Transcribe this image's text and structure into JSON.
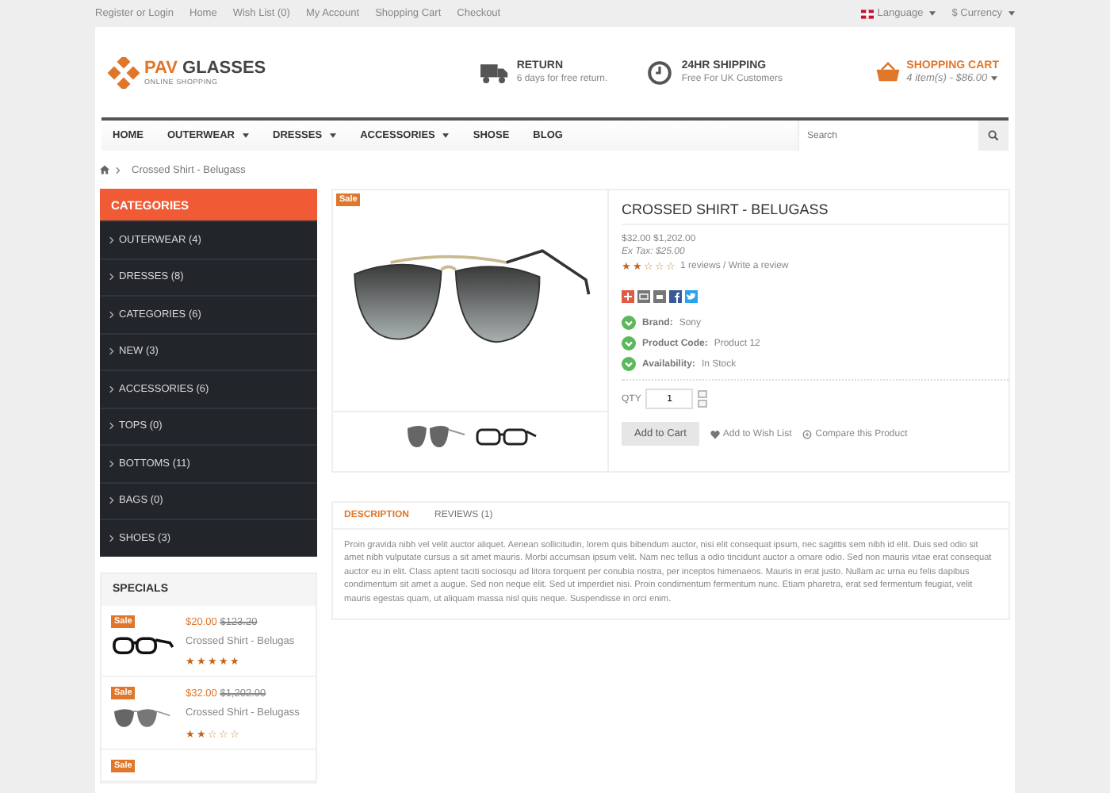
{
  "top_links": [
    "Register or Login",
    "Home",
    "Wish List (0)",
    "My Account",
    "Shopping Cart",
    "Checkout"
  ],
  "top_right": [
    {
      "kind": "language",
      "label": "Language"
    },
    {
      "kind": "currency",
      "label": "$ Currency"
    }
  ],
  "logo": {
    "brand": "PAV",
    "name": "GLASSES",
    "tagline": "ONLINE SHOPPING"
  },
  "features": [
    {
      "kind": "truck",
      "title": "RETURN",
      "text": "6 days for free return."
    },
    {
      "kind": "clock",
      "title": "24HR SHIPPING",
      "text": "Free For UK Customers"
    }
  ],
  "cart": {
    "title": "SHOPPING CART",
    "summary": "4 item(s) - $86.00"
  },
  "nav": [
    {
      "label": "HOME",
      "dropdown": false
    },
    {
      "label": "OUTERWEAR",
      "dropdown": true
    },
    {
      "label": "DRESSES",
      "dropdown": true
    },
    {
      "label": "ACCESSORIES",
      "dropdown": true
    },
    {
      "label": "SHOSE",
      "dropdown": false
    },
    {
      "label": "BLOG",
      "dropdown": false
    }
  ],
  "search": {
    "placeholder": "Search"
  },
  "breadcrumb": "Crossed Shirt - Belugass",
  "categories": {
    "title": "CATEGORIES",
    "items": [
      "OUTERWEAR (4)",
      "DRESSES (8)",
      "CATEGORIES (6)",
      "NEW (3)",
      "ACCESSORIES (6)",
      "TOPS (0)",
      "BOTTOMS (11)",
      "BAGS (0)",
      "SHOES (3)"
    ]
  },
  "specials": {
    "title": "SPECIALS",
    "items": [
      {
        "badge": "Sale",
        "kind": "frames",
        "price": "$20.00",
        "old_price": "$123.20",
        "name": "Crossed Shirt - Belugas",
        "stars": 5
      },
      {
        "badge": "Sale",
        "kind": "aviator",
        "price": "$32.00",
        "old_price": "$1,202.00",
        "name": "Crossed Shirt - Belugass",
        "stars": 2
      },
      {
        "badge": "Sale"
      }
    ]
  },
  "product": {
    "badge": "Sale",
    "title": "CROSSED SHIRT - BELUGASS",
    "price": "$32.00 $1,202.00",
    "ex_tax": "Ex Tax: $25.00",
    "stars": 2,
    "reviews": "1 reviews / Write a review",
    "details": [
      {
        "label": "Brand:",
        "value": "Sony"
      },
      {
        "label": "Product Code:",
        "value": "Product 12"
      },
      {
        "label": "Availability:",
        "value": "In Stock"
      }
    ],
    "qty_label": "QTY",
    "qty": "1",
    "add_to_cart": "Add to Cart",
    "wish": "Add to Wish List",
    "compare": "Compare this Product"
  },
  "tabs": [
    {
      "label": "DESCRIPTION",
      "selected": true
    },
    {
      "label": "REVIEWS (1)",
      "selected": false
    }
  ],
  "description": "Proin gravida nibh vel velit auctor aliquet. Aenean sollicitudin, lorem quis bibendum auctor, nisi elit consequat ipsum, nec sagittis sem nibh id elit. Duis sed odio sit amet nibh vulputate cursus a sit amet mauris. Morbi accumsan ipsum velit. Nam nec tellus a odio tincidunt auctor a ornare odio. Sed non mauris vitae erat consequat auctor eu in elit. Class aptent taciti sociosqu ad litora torquent per conubia nostra, per inceptos himenaeos. Mauris in erat justo. Nullam ac urna eu felis dapibus condimentum sit amet a augue. Sed non neque elit. Sed ut imperdiet nisi. Proin condimentum fermentum nunc. Etiam pharetra, erat sed fermentum feugiat, velit mauris egestas quam, ut aliquam massa nisl quis neque. Suspendisse in orci enim."
}
